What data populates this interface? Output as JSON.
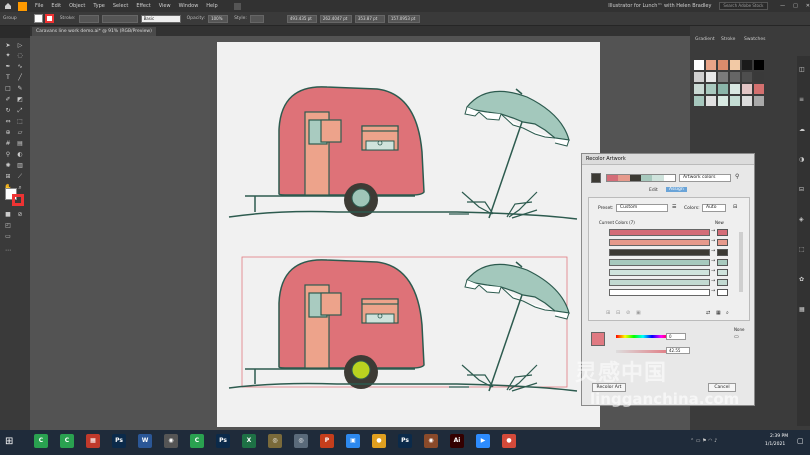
{
  "menu": {
    "items": [
      "File",
      "Edit",
      "Object",
      "Type",
      "Select",
      "Effect",
      "View",
      "Window",
      "Help"
    ],
    "title": "Illustrator for Lunch™ with Helen Bradley",
    "search_placeholder": "Search Adobe Stock"
  },
  "control": {
    "selection_label": "Group",
    "stroke_label": "Stroke:",
    "basic_label": "Basic",
    "opacity_label": "Opacity:",
    "opacity_value": "100%",
    "style_label": "Style:",
    "x_value": "493.435 pt",
    "y_value": "262.4047 pt",
    "w_value": "353.87 pt",
    "h_value": "157.0953 pt"
  },
  "document": {
    "tab_label": "Caravans line work demo.ai* @ 91% (RGB/Preview)",
    "zoom": "91%",
    "status": "Selection"
  },
  "right_panel": {
    "tabs": [
      "Gradient",
      "Stroke",
      "Swatches"
    ],
    "swatch_colors": [
      "#ffffff",
      "#e9a488",
      "#d98b6c",
      "#f2c9a5",
      "#1a1a1a",
      "#000000",
      "#cfcfcf",
      "#e7e7e7",
      "#7b7b7b",
      "#666666",
      "#4e4e4e",
      "#3a3a3a",
      "#c9d9d3",
      "#a9c9bf",
      "#8ab5a9",
      "#d9e8e2",
      "#e3c5c5",
      "#d4706f",
      "#a6c7bd",
      "#e0e0e0",
      "#d7e8e1",
      "#c4ddd4",
      "#dcdcdc",
      "#a9a9a9"
    ]
  },
  "recolor": {
    "title": "Recolor Artwork",
    "artwork_colors_label": "Artwork colors",
    "edit_tab": "Edit",
    "assign_tab": "Assign",
    "preset_label": "Preset:",
    "preset_value": "Custom",
    "colors_label": "Colors:",
    "colors_value": "Auto",
    "current_colors_label": "Current Colors (7)",
    "new_label": "New",
    "none_label": "None",
    "k_value": "0",
    "s_value": "42.55",
    "recolor_button": "Recolor Art",
    "cancel_button": "Cancel",
    "rows": [
      {
        "current": "#d46d78",
        "new": "#d46d78"
      },
      {
        "current": "#e69a8c",
        "new": "#e69a8c"
      },
      {
        "current": "#3c3a34",
        "new": "#3c3a34"
      },
      {
        "current": "#a7c9bd",
        "new": "#a7c9bd"
      },
      {
        "current": "#cfe3dc",
        "new": "#cfe3dc"
      },
      {
        "current": "#c2d9d1",
        "new": "#c2d9d1"
      },
      {
        "current": "#ffffff",
        "new": "#ffffff"
      }
    ],
    "selected_color": "#e07a82",
    "strip_colors": [
      "#d46d78",
      "#e69a8c",
      "#3c3a34",
      "#a7c9bd",
      "#cfe3dc",
      "#ffffff"
    ]
  },
  "taskbar": {
    "time": "2:39 PM",
    "date": "1/1/2021",
    "apps": [
      {
        "label": "C",
        "color": "#2aa150"
      },
      {
        "label": "C",
        "color": "#2aa150"
      },
      {
        "label": "▦",
        "color": "#c0392b"
      },
      {
        "label": "Ps",
        "color": "#0b2a4a"
      },
      {
        "label": "W",
        "color": "#2b5797"
      },
      {
        "label": "◉",
        "color": "#555"
      },
      {
        "label": "C",
        "color": "#2aa150"
      },
      {
        "label": "Ps",
        "color": "#0b2a4a"
      },
      {
        "label": "X",
        "color": "#1e7145"
      },
      {
        "label": "◎",
        "color": "#7a6a3a"
      },
      {
        "label": "◎",
        "color": "#5a6a7a"
      },
      {
        "label": "P",
        "color": "#c43e1c"
      },
      {
        "label": "▣",
        "color": "#2d89ef"
      },
      {
        "label": "●",
        "color": "#e0a020"
      },
      {
        "label": "Ps",
        "color": "#0b2a4a"
      },
      {
        "label": "◉",
        "color": "#8a4a2a"
      },
      {
        "label": "Ai",
        "color": "#330000"
      },
      {
        "label": "▶",
        "color": "#2d8cff"
      },
      {
        "label": "●",
        "color": "#d34a3a"
      }
    ]
  },
  "watermark": {
    "text": "灵感中国",
    "url": "lingganchina.com"
  },
  "colors": {
    "caravan_body": "#de7278",
    "caravan_door": "#eda38b",
    "window_fill": "#a9cbc0",
    "wheel": "#3d3b35",
    "hub": "#9fc5b8",
    "hub_selected": "#b9d320",
    "umbrella": "#a3c8bc",
    "umbrella_trim": "#ffffff",
    "line": "#2d5b4f",
    "selection_box": "#e27a80"
  }
}
